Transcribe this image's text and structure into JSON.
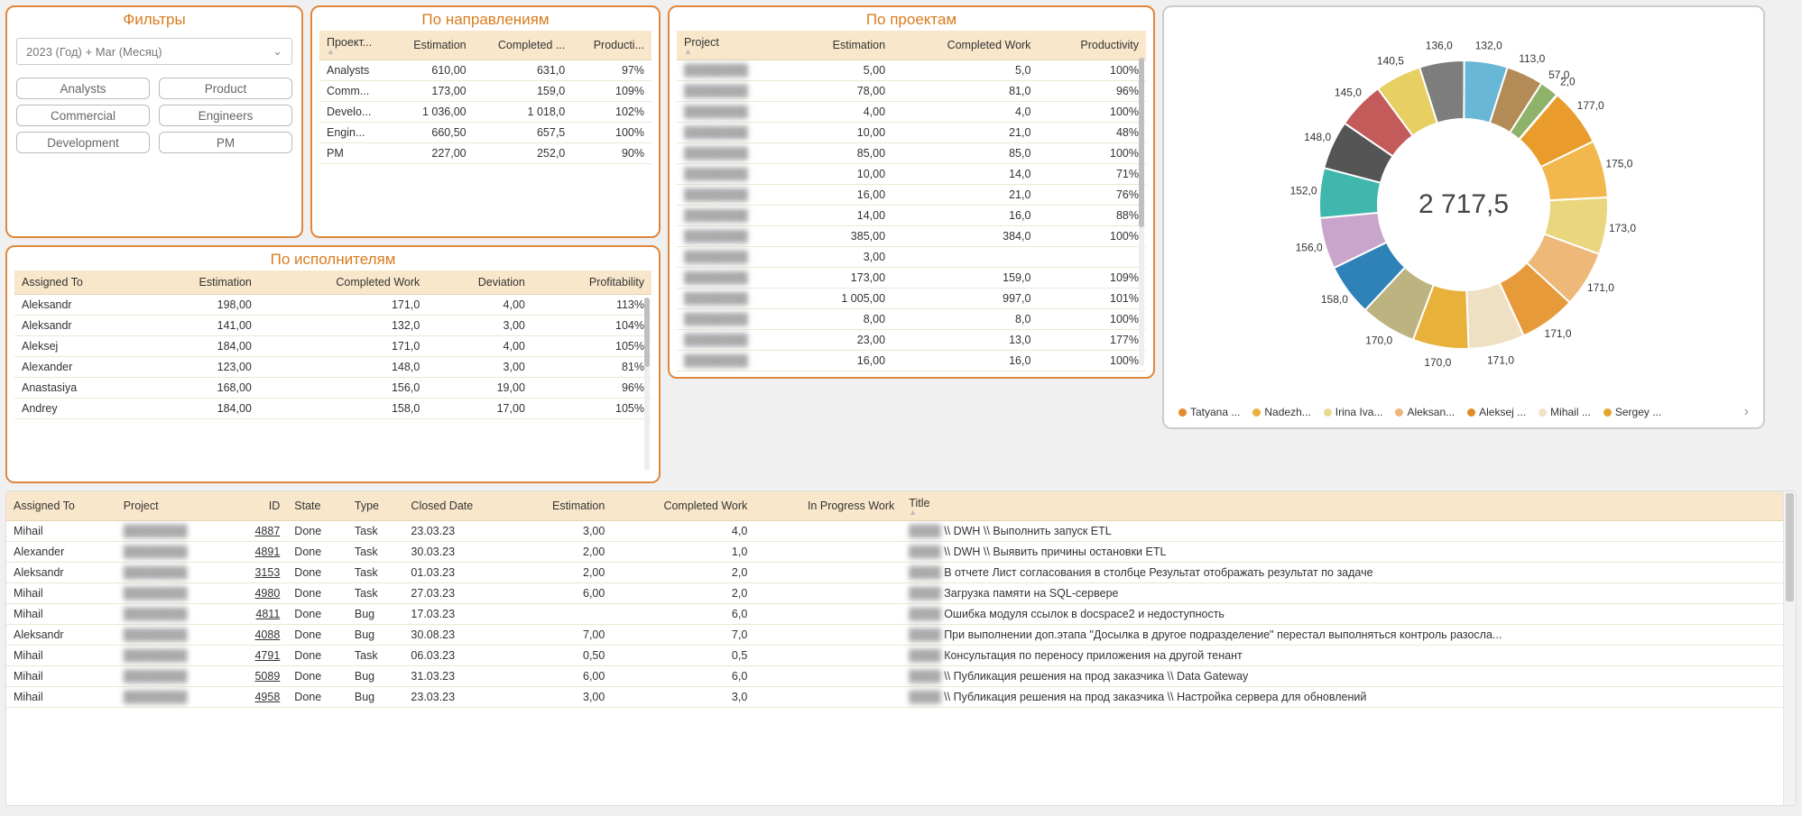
{
  "filters": {
    "title": "Фильтры",
    "dropdown": "2023 (Год) + Mar (Месяц)",
    "buttons": [
      "Analysts",
      "Product",
      "Commercial",
      "Engineers",
      "Development",
      "PM"
    ]
  },
  "directions": {
    "title": "По направлениям",
    "headers": [
      "Проект...",
      "Estimation",
      "Completed ...",
      "Producti..."
    ],
    "rows": [
      {
        "name": "Analysts",
        "est": "610,00",
        "cw": "631,0",
        "prod": "97%"
      },
      {
        "name": "Comm...",
        "est": "173,00",
        "cw": "159,0",
        "prod": "109%"
      },
      {
        "name": "Develo...",
        "est": "1 036,00",
        "cw": "1 018,0",
        "prod": "102%"
      },
      {
        "name": "Engin...",
        "est": "660,50",
        "cw": "657,5",
        "prod": "100%"
      },
      {
        "name": "PM",
        "est": "227,00",
        "cw": "252,0",
        "prod": "90%"
      }
    ]
  },
  "executors": {
    "title": "По исполнителям",
    "headers": [
      "Assigned To",
      "Estimation",
      "Completed Work",
      "Deviation",
      "Profitability"
    ],
    "rows": [
      {
        "name": "Aleksandr",
        "est": "198,00",
        "cw": "171,0",
        "dev": "4,00",
        "prof": "113%"
      },
      {
        "name": "Aleksandr",
        "est": "141,00",
        "cw": "132,0",
        "dev": "3,00",
        "prof": "104%"
      },
      {
        "name": "Aleksej",
        "est": "184,00",
        "cw": "171,0",
        "dev": "4,00",
        "prof": "105%"
      },
      {
        "name": "Alexander",
        "est": "123,00",
        "cw": "148,0",
        "dev": "3,00",
        "prof": "81%"
      },
      {
        "name": "Anastasiya",
        "est": "168,00",
        "cw": "156,0",
        "dev": "19,00",
        "prof": "96%"
      },
      {
        "name": "Andrey",
        "est": "184,00",
        "cw": "158,0",
        "dev": "17,00",
        "prof": "105%"
      }
    ]
  },
  "projects": {
    "title": "По проектам",
    "headers": [
      "Project",
      "Estimation",
      "Completed Work",
      "Productivity"
    ],
    "rows": [
      {
        "est": "5,00",
        "cw": "5,0",
        "prod": "100%"
      },
      {
        "est": "78,00",
        "cw": "81,0",
        "prod": "96%"
      },
      {
        "est": "4,00",
        "cw": "4,0",
        "prod": "100%"
      },
      {
        "est": "10,00",
        "cw": "21,0",
        "prod": "48%"
      },
      {
        "est": "85,00",
        "cw": "85,0",
        "prod": "100%"
      },
      {
        "est": "10,00",
        "cw": "14,0",
        "prod": "71%"
      },
      {
        "est": "16,00",
        "cw": "21,0",
        "prod": "76%"
      },
      {
        "est": "14,00",
        "cw": "16,0",
        "prod": "88%"
      },
      {
        "est": "385,00",
        "cw": "384,0",
        "prod": "100%"
      },
      {
        "est": "3,00",
        "cw": "",
        "prod": ""
      },
      {
        "est": "173,00",
        "cw": "159,0",
        "prod": "109%"
      },
      {
        "est": "1 005,00",
        "cw": "997,0",
        "prod": "101%"
      },
      {
        "est": "8,00",
        "cw": "8,0",
        "prod": "100%"
      },
      {
        "est": "23,00",
        "cw": "13,0",
        "prod": "177%"
      },
      {
        "est": "16,00",
        "cw": "16,0",
        "prod": "100%"
      }
    ]
  },
  "donut": {
    "center": "2 717,5",
    "legend": [
      {
        "label": "Tatyana ...",
        "color": "#e38a2b"
      },
      {
        "label": "Nadezh...",
        "color": "#ecb13a"
      },
      {
        "label": "Irina Iva...",
        "color": "#e9da92"
      },
      {
        "label": "Aleksan...",
        "color": "#efb57a"
      },
      {
        "label": "Aleksej ...",
        "color": "#e38a2b"
      },
      {
        "label": "Mihail ...",
        "color": "#efe2c5"
      },
      {
        "label": "Sergey ...",
        "color": "#e3a52b"
      }
    ]
  },
  "chart_data": {
    "type": "pie",
    "title": "",
    "center_value": 2717.5,
    "note": "Donut chart of completed work per person; arc labels are the numeric values.",
    "series": [
      {
        "name": "Tatyana ...",
        "value": 177.0,
        "color": "#e99c2c"
      },
      {
        "name": "Nadezh...",
        "value": 175.0,
        "color": "#f2b74d"
      },
      {
        "name": "Irina Iva...",
        "value": 173.0,
        "color": "#e9d67f"
      },
      {
        "name": "Aleksan...",
        "value": 171.0,
        "color": "#eeb879"
      },
      {
        "name": "Aleksej ...",
        "value": 171.0,
        "color": "#e79a3a"
      },
      {
        "name": "Mihail ...",
        "value": 171.0,
        "color": "#efe0c3"
      },
      {
        "name": "Sergey ...",
        "value": 170.0,
        "color": "#e7b13a"
      },
      {
        "name": "",
        "value": 170.0,
        "color": "#bcb380"
      },
      {
        "name": "",
        "value": 158.0,
        "color": "#2f82b8"
      },
      {
        "name": "",
        "value": 156.0,
        "color": "#c9a5cb"
      },
      {
        "name": "",
        "value": 152.0,
        "color": "#3fb7ad"
      },
      {
        "name": "",
        "value": 148.0,
        "color": "#555555"
      },
      {
        "name": "",
        "value": 145.0,
        "color": "#c35b5b"
      },
      {
        "name": "",
        "value": 140.5,
        "color": "#e7cf63"
      },
      {
        "name": "",
        "value": 136.0,
        "color": "#7d7d7d"
      },
      {
        "name": "",
        "value": 132.0,
        "color": "#69b7d6"
      },
      {
        "name": "",
        "value": 113.0,
        "color": "#b38b57"
      },
      {
        "name": "",
        "value": 57.0,
        "color": "#8fb26b"
      },
      {
        "name": "",
        "value": 2.0,
        "color": "#cd8f3c"
      }
    ]
  },
  "detail": {
    "headers": [
      "Assigned To",
      "Project",
      "ID",
      "State",
      "Type",
      "Closed Date",
      "Estimation",
      "Completed Work",
      "In Progress Work",
      "Title"
    ],
    "rows": [
      {
        "a": "Mihail",
        "id": "4887",
        "st": "Done",
        "ty": "Task",
        "cd": "23.03.23",
        "est": "3,00",
        "cw": "4,0",
        "ip": "",
        "title": "\\\\ DWH \\\\ Выполнить запуск ETL"
      },
      {
        "a": "Alexander",
        "id": "4891",
        "st": "Done",
        "ty": "Task",
        "cd": "30.03.23",
        "est": "2,00",
        "cw": "1,0",
        "ip": "",
        "title": "\\\\ DWH \\\\ Выявить причины остановки ETL"
      },
      {
        "a": "Aleksandr",
        "id": "3153",
        "st": "Done",
        "ty": "Task",
        "cd": "01.03.23",
        "est": "2,00",
        "cw": "2,0",
        "ip": "",
        "title": "В отчете Лист согласования в столбце Результат отображать результат по задаче"
      },
      {
        "a": "Mihail",
        "id": "4980",
        "st": "Done",
        "ty": "Task",
        "cd": "27.03.23",
        "est": "6,00",
        "cw": "2,0",
        "ip": "",
        "title": "Загрузка памяти на SQL-сервере"
      },
      {
        "a": "Mihail",
        "id": "4811",
        "st": "Done",
        "ty": "Bug",
        "cd": "17.03.23",
        "est": "",
        "cw": "6,0",
        "ip": "",
        "title": "Ошибка модуля ссылок в docspace2 и недоступность"
      },
      {
        "a": "Aleksandr",
        "id": "4088",
        "st": "Done",
        "ty": "Bug",
        "cd": "30.08.23",
        "est": "7,00",
        "cw": "7,0",
        "ip": "",
        "title": "При выполнении доп.этапа \"Досылка в другое подразделение\" перестал выполняться контроль разосла..."
      },
      {
        "a": "Mihail",
        "id": "4791",
        "st": "Done",
        "ty": "Task",
        "cd": "06.03.23",
        "est": "0,50",
        "cw": "0,5",
        "ip": "",
        "title": "Консультация по переносу приложения на другой тенант"
      },
      {
        "a": "Mihail",
        "id": "5089",
        "st": "Done",
        "ty": "Bug",
        "cd": "31.03.23",
        "est": "6,00",
        "cw": "6,0",
        "ip": "",
        "title": "\\\\ Публикация решения на прод заказчика \\\\ Data Gateway"
      },
      {
        "a": "Mihail",
        "id": "4958",
        "st": "Done",
        "ty": "Bug",
        "cd": "23.03.23",
        "est": "3,00",
        "cw": "3,0",
        "ip": "",
        "title": "\\\\ Публикация решения на прод заказчика \\\\ Настройка сервера для обновлений"
      }
    ]
  }
}
